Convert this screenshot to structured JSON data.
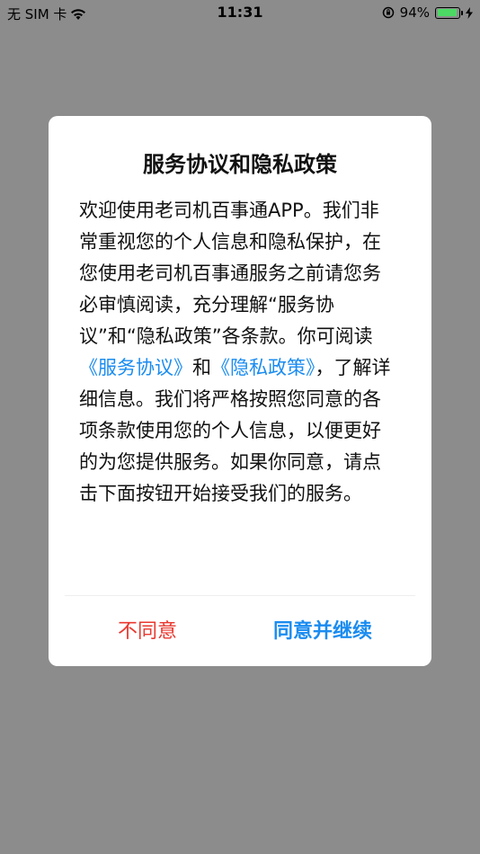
{
  "status_bar": {
    "carrier": "无 SIM 卡",
    "time": "11:31",
    "battery_percent": "94%",
    "battery_level": 0.94,
    "colors": {
      "battery_fill": "#4cd964"
    }
  },
  "dialog": {
    "title": "服务协议和隐私政策",
    "body_part1": "欢迎使用老司机百事通APP。我们非常重视您的个人信息和隐私保护，在您使用老司机百事通服务之前请您务必审慎阅读，充分理解“服务协议”和“隐私政策”各条款。你可阅读",
    "link_service": "《服务协议》",
    "body_and": "和",
    "link_privacy": "《隐私政策》",
    "body_part2": "，了解详细信息。我们将严格按照您同意的各项条款使用您的个人信息，以便更好的为您提供服务。如果你同意，请点击下面按钮开始接受我们的服务。",
    "disagree_label": "不同意",
    "agree_label": "同意并继续",
    "colors": {
      "link": "#1a8cf0",
      "disagree": "#e8382f",
      "agree": "#1a8cf0"
    }
  }
}
